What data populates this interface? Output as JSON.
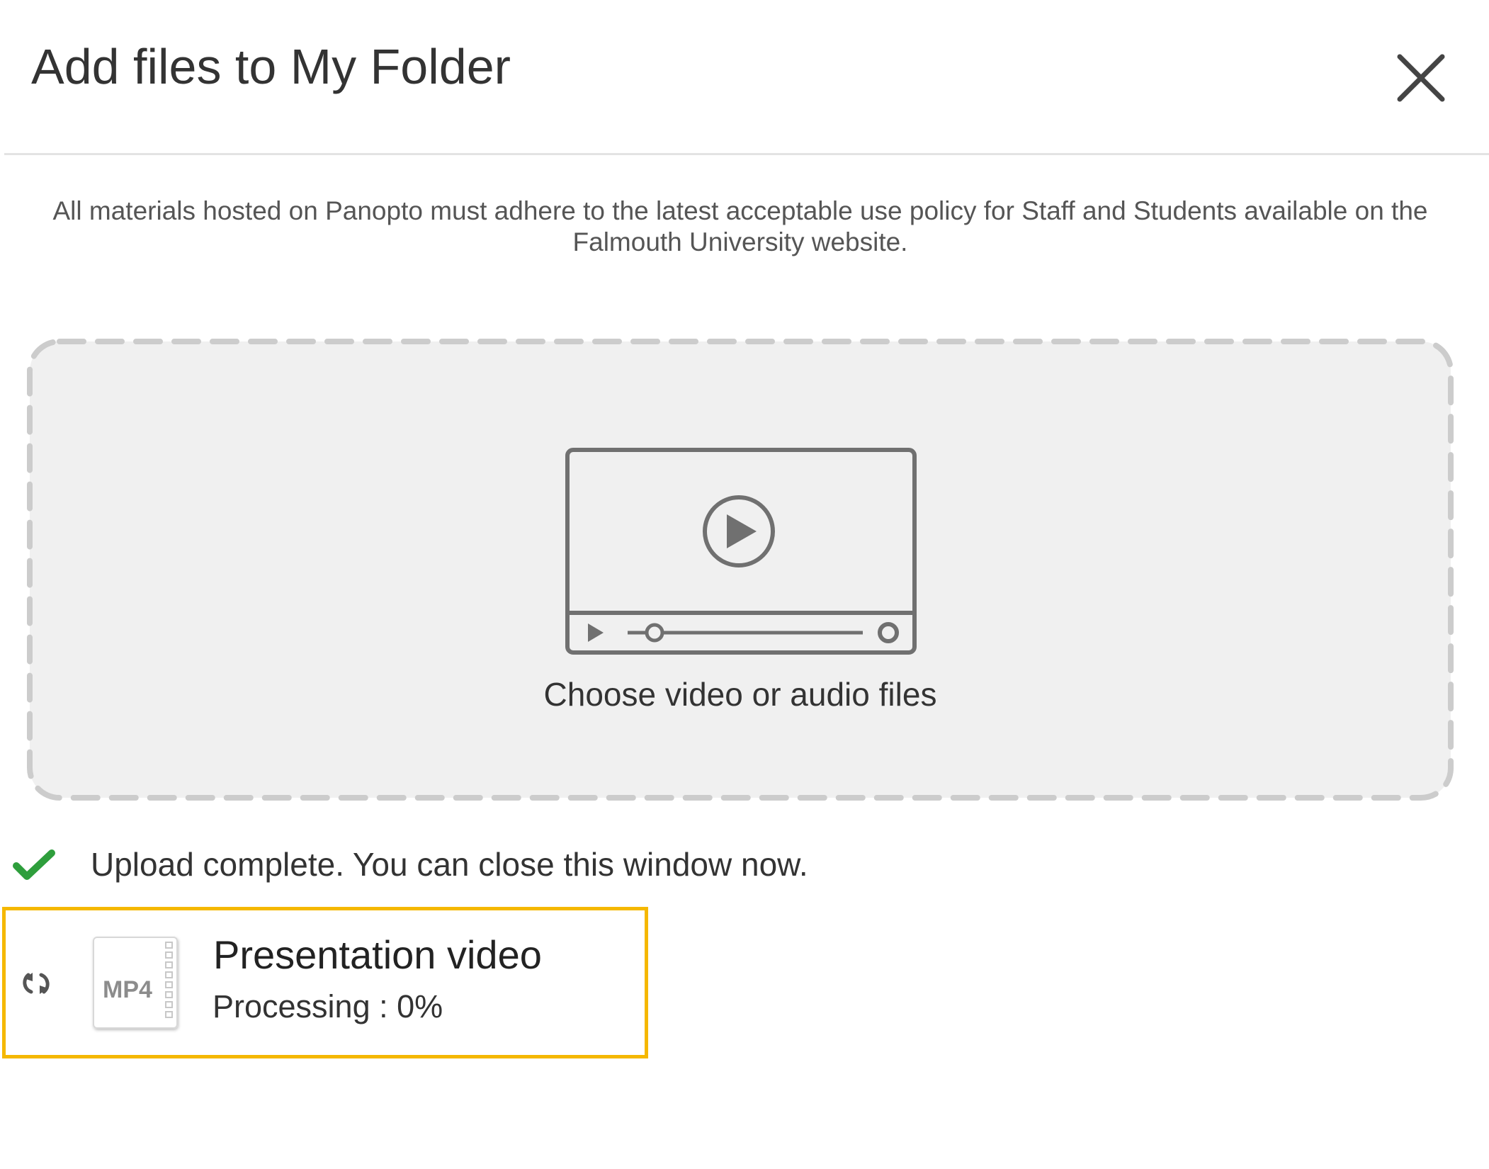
{
  "dialog": {
    "title": "Add files to My Folder",
    "close_icon": "close-icon",
    "policy_text": "All materials hosted on Panopto must adhere to the latest acceptable use policy for Staff and Students available on the Falmouth University website."
  },
  "dropzone": {
    "label": "Choose video or audio files",
    "icon": "video-player-icon"
  },
  "status": {
    "icon": "checkmark-icon",
    "message": "Upload complete. You can close this window now."
  },
  "upload": {
    "file_name": "Presentation video",
    "file_type": "MP4",
    "status_text": "Processing : 0%",
    "progress_percent": 0,
    "icon": "refresh-icon"
  },
  "colors": {
    "highlight_border": "#f5b800",
    "success_check": "#2e9e3c",
    "dropzone_bg": "#f0f0f0",
    "dropzone_border": "#cccccc",
    "icon_gray": "#707070"
  }
}
